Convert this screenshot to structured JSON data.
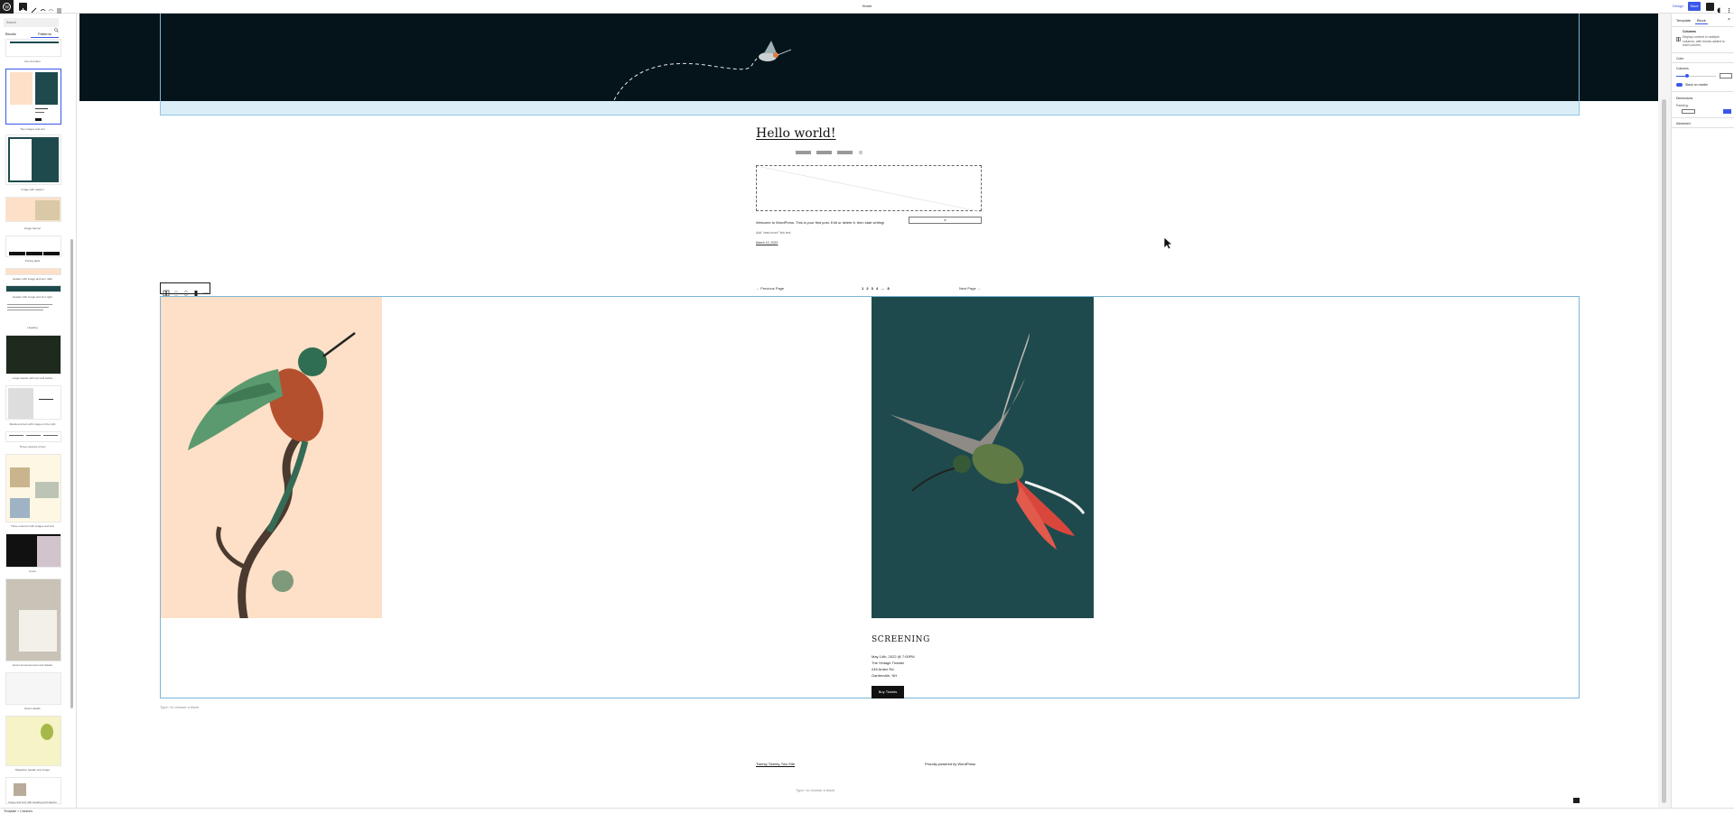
{
  "topbar": {
    "document_title": "Home",
    "preview_label": "Design",
    "save_label": "Save"
  },
  "left_sidebar": {
    "search_placeholder": "Search",
    "tabs": [
      "Blocks",
      "Patterns"
    ],
    "active_tab": "Patterns",
    "patterns": [
      {
        "label": "Icon & button"
      },
      {
        "label": "Two images and text"
      },
      {
        "label": "Image with caption"
      },
      {
        "label": "Image banner"
      },
      {
        "label": "Pricing table"
      },
      {
        "label": "Header with image and text, dark"
      },
      {
        "label": "Header with image and text, light"
      },
      {
        "label": "Heading"
      },
      {
        "label": "Large header with text and button"
      },
      {
        "label": "Media and text with image on the right"
      },
      {
        "label": "Three columns of text"
      },
      {
        "label": "Three columns with images and text"
      },
      {
        "label": "Cover"
      },
      {
        "label": "Event announcement and details"
      },
      {
        "label": "Event details"
      },
      {
        "label": "Magazine header and image"
      },
      {
        "label": "Image and text with heading and caption"
      }
    ]
  },
  "canvas": {
    "post_title": "Hello world!",
    "excerpt": "Welcome to WordPress. This is your first post. Edit or delete it, then start writing!",
    "excerpt_field": "#",
    "tags_line": "Add \"read more\" link text",
    "post_date": "March 10, 2023",
    "pagination": {
      "previous": "← Previous Page",
      "numbers": "1 2 3 4 … 8",
      "next": "Next Page →"
    },
    "event": {
      "title": "SCREENING",
      "details": [
        "May 14th, 2022 @ 7:00PM",
        "The Vintagé Theater",
        "245 Arden Rd.",
        "Gardenville, NH"
      ],
      "button": "Buy Tickets"
    },
    "append_prompt": "Type / to choose a block",
    "footer_site": "Twenty Twenty-Two Site",
    "footer_credit": "Proudly powered by WordPress",
    "footer_append": "Type / to choose a block"
  },
  "right_sidebar": {
    "tabs": [
      "Template",
      "Block"
    ],
    "active_tab": "Block",
    "block_name": "Columns",
    "block_description": "Display content in multiple columns, with blocks added to each column.",
    "sections": [
      "Color",
      "Columns",
      "Dimensions",
      "Advanced"
    ],
    "stack_on_mobile": "Stack on mobile",
    "padding_label": "Padding"
  },
  "statusbar": {
    "breadcrumb": "Template  >  Columns"
  },
  "colors": {
    "accent": "#3858e9",
    "header_bg": "#04141a",
    "peach": "#fde0c7",
    "teal": "#1e4a4d",
    "selection": "#7ab6d8"
  }
}
